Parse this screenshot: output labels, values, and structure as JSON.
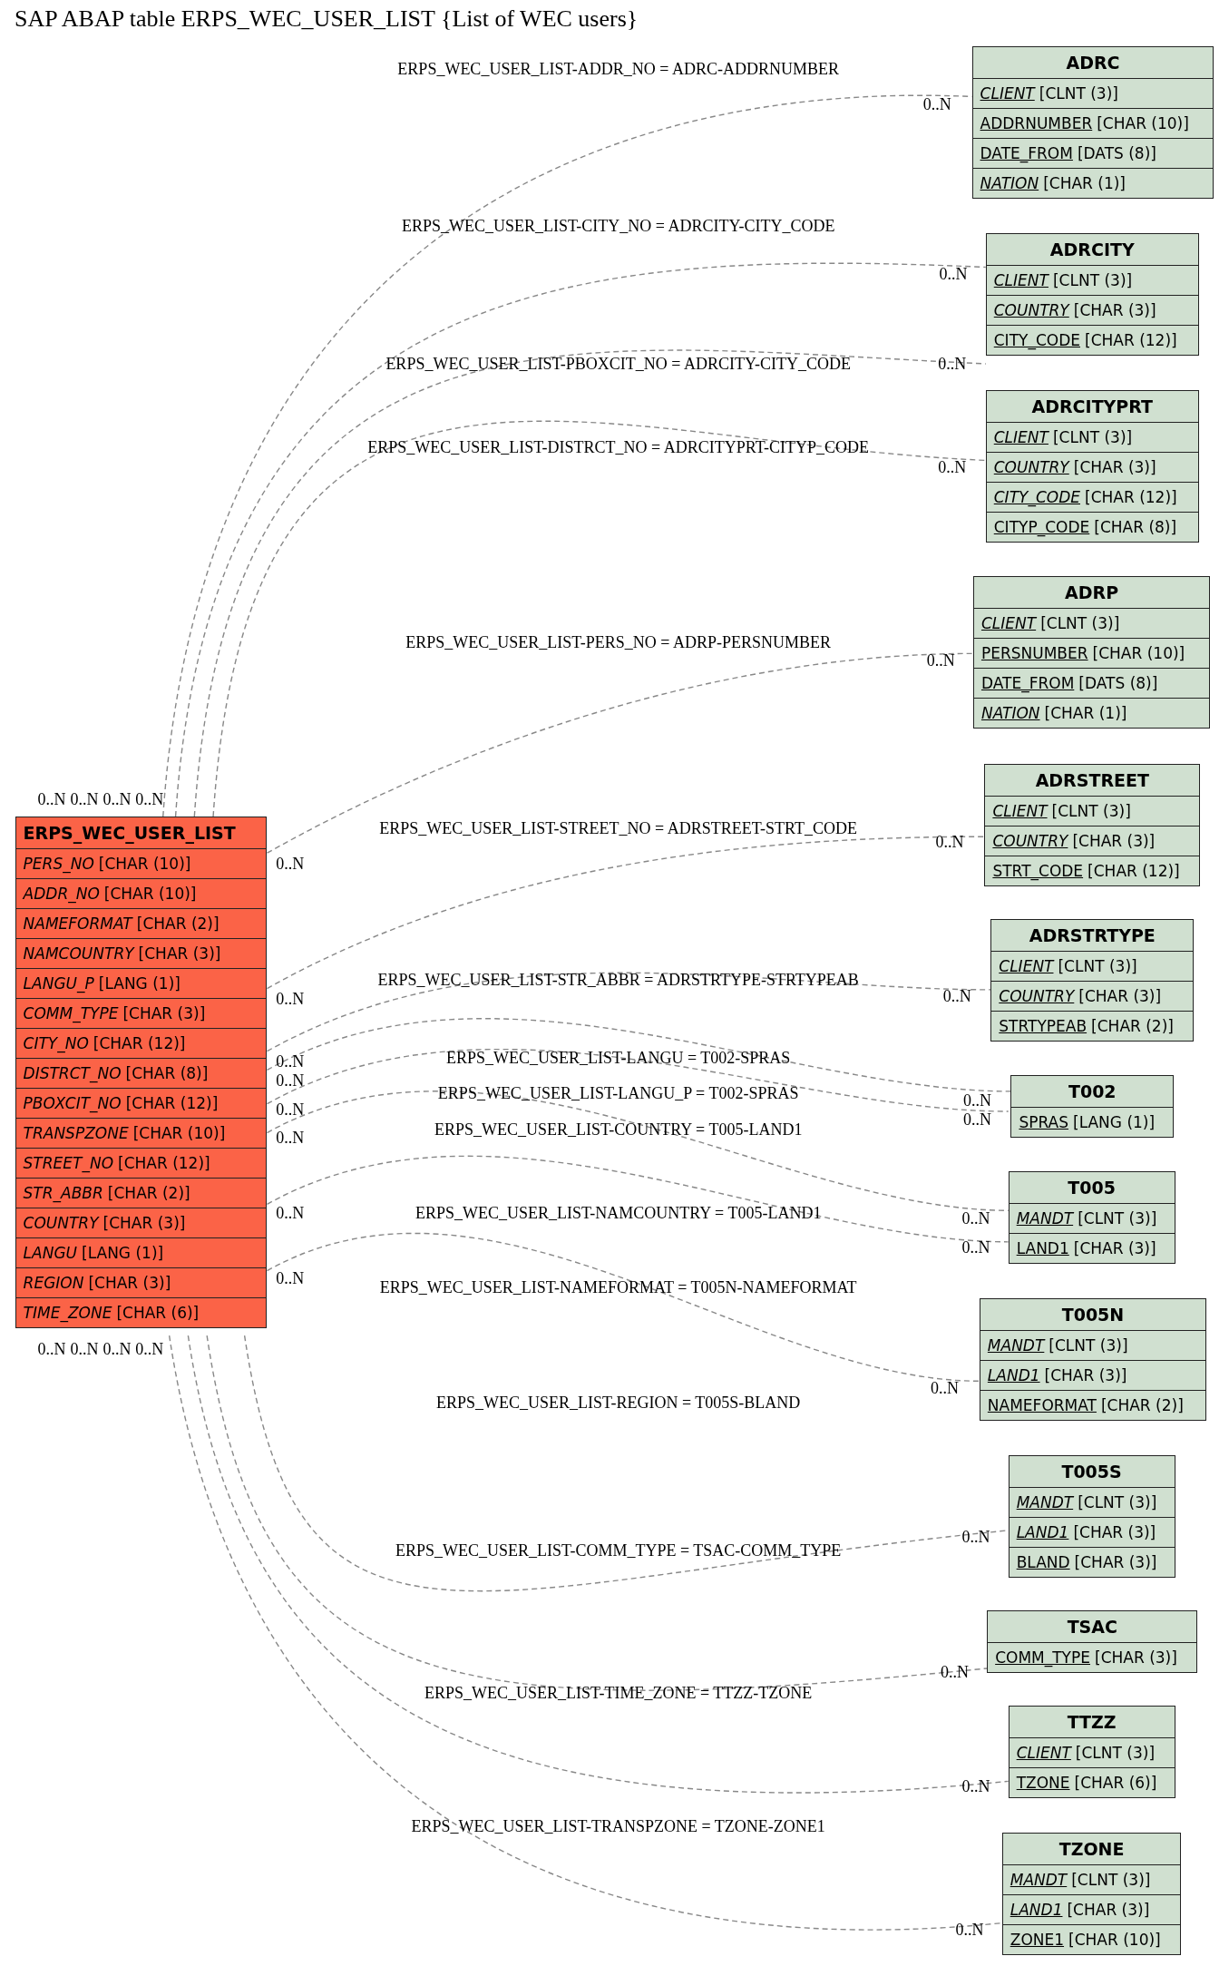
{
  "title": "SAP ABAP table ERPS_WEC_USER_LIST {List of WEC users}",
  "tables": [
    {
      "name": "ERPS_WEC_USER_LIST",
      "kind": "main",
      "fields": [
        {
          "name": "PERS_NO",
          "type": "[CHAR (10)]",
          "key": false,
          "italic": true
        },
        {
          "name": "ADDR_NO",
          "type": "[CHAR (10)]",
          "key": false,
          "italic": true
        },
        {
          "name": "NAMEFORMAT",
          "type": "[CHAR (2)]",
          "key": false,
          "italic": true
        },
        {
          "name": "NAMCOUNTRY",
          "type": "[CHAR (3)]",
          "key": false,
          "italic": true
        },
        {
          "name": "LANGU_P",
          "type": "[LANG (1)]",
          "key": false,
          "italic": true
        },
        {
          "name": "COMM_TYPE",
          "type": "[CHAR (3)]",
          "key": false,
          "italic": true
        },
        {
          "name": "CITY_NO",
          "type": "[CHAR (12)]",
          "key": false,
          "italic": true
        },
        {
          "name": "DISTRCT_NO",
          "type": "[CHAR (8)]",
          "key": false,
          "italic": true
        },
        {
          "name": "PBOXCIT_NO",
          "type": "[CHAR (12)]",
          "key": false,
          "italic": true
        },
        {
          "name": "TRANSPZONE",
          "type": "[CHAR (10)]",
          "key": false,
          "italic": true
        },
        {
          "name": "STREET_NO",
          "type": "[CHAR (12)]",
          "key": false,
          "italic": true
        },
        {
          "name": "STR_ABBR",
          "type": "[CHAR (2)]",
          "key": false,
          "italic": true
        },
        {
          "name": "COUNTRY",
          "type": "[CHAR (3)]",
          "key": false,
          "italic": true
        },
        {
          "name": "LANGU",
          "type": "[LANG (1)]",
          "key": false,
          "italic": true
        },
        {
          "name": "REGION",
          "type": "[CHAR (3)]",
          "key": false,
          "italic": true
        },
        {
          "name": "TIME_ZONE",
          "type": "[CHAR (6)]",
          "key": false,
          "italic": true
        }
      ]
    },
    {
      "name": "ADRC",
      "kind": "related",
      "fields": [
        {
          "name": "CLIENT",
          "type": "[CLNT (3)]",
          "key": true,
          "italic": true
        },
        {
          "name": "ADDRNUMBER",
          "type": "[CHAR (10)]",
          "key": true,
          "italic": false
        },
        {
          "name": "DATE_FROM",
          "type": "[DATS (8)]",
          "key": true,
          "italic": false
        },
        {
          "name": "NATION",
          "type": "[CHAR (1)]",
          "key": true,
          "italic": true
        }
      ]
    },
    {
      "name": "ADRCITY",
      "kind": "related",
      "fields": [
        {
          "name": "CLIENT",
          "type": "[CLNT (3)]",
          "key": true,
          "italic": true
        },
        {
          "name": "COUNTRY",
          "type": "[CHAR (3)]",
          "key": true,
          "italic": true
        },
        {
          "name": "CITY_CODE",
          "type": "[CHAR (12)]",
          "key": true,
          "italic": false
        }
      ]
    },
    {
      "name": "ADRCITYPRT",
      "kind": "related",
      "fields": [
        {
          "name": "CLIENT",
          "type": "[CLNT (3)]",
          "key": true,
          "italic": true
        },
        {
          "name": "COUNTRY",
          "type": "[CHAR (3)]",
          "key": true,
          "italic": true
        },
        {
          "name": "CITY_CODE",
          "type": "[CHAR (12)]",
          "key": true,
          "italic": true
        },
        {
          "name": "CITYP_CODE",
          "type": "[CHAR (8)]",
          "key": true,
          "italic": false
        }
      ]
    },
    {
      "name": "ADRP",
      "kind": "related",
      "fields": [
        {
          "name": "CLIENT",
          "type": "[CLNT (3)]",
          "key": true,
          "italic": true
        },
        {
          "name": "PERSNUMBER",
          "type": "[CHAR (10)]",
          "key": true,
          "italic": false
        },
        {
          "name": "DATE_FROM",
          "type": "[DATS (8)]",
          "key": true,
          "italic": false
        },
        {
          "name": "NATION",
          "type": "[CHAR (1)]",
          "key": true,
          "italic": true
        }
      ]
    },
    {
      "name": "ADRSTREET",
      "kind": "related",
      "fields": [
        {
          "name": "CLIENT",
          "type": "[CLNT (3)]",
          "key": true,
          "italic": true
        },
        {
          "name": "COUNTRY",
          "type": "[CHAR (3)]",
          "key": true,
          "italic": true
        },
        {
          "name": "STRT_CODE",
          "type": "[CHAR (12)]",
          "key": true,
          "italic": false
        }
      ]
    },
    {
      "name": "ADRSTRTYPE",
      "kind": "related",
      "fields": [
        {
          "name": "CLIENT",
          "type": "[CLNT (3)]",
          "key": true,
          "italic": true
        },
        {
          "name": "COUNTRY",
          "type": "[CHAR (3)]",
          "key": true,
          "italic": true
        },
        {
          "name": "STRTYPEAB",
          "type": "[CHAR (2)]",
          "key": true,
          "italic": false
        }
      ]
    },
    {
      "name": "T002",
      "kind": "related",
      "fields": [
        {
          "name": "SPRAS",
          "type": "[LANG (1)]",
          "key": true,
          "italic": false
        }
      ]
    },
    {
      "name": "T005",
      "kind": "related",
      "fields": [
        {
          "name": "MANDT",
          "type": "[CLNT (3)]",
          "key": true,
          "italic": true
        },
        {
          "name": "LAND1",
          "type": "[CHAR (3)]",
          "key": true,
          "italic": false
        }
      ]
    },
    {
      "name": "T005N",
      "kind": "related",
      "fields": [
        {
          "name": "MANDT",
          "type": "[CLNT (3)]",
          "key": true,
          "italic": true
        },
        {
          "name": "LAND1",
          "type": "[CHAR (3)]",
          "key": true,
          "italic": true
        },
        {
          "name": "NAMEFORMAT",
          "type": "[CHAR (2)]",
          "key": true,
          "italic": false
        }
      ]
    },
    {
      "name": "T005S",
      "kind": "related",
      "fields": [
        {
          "name": "MANDT",
          "type": "[CLNT (3)]",
          "key": true,
          "italic": true
        },
        {
          "name": "LAND1",
          "type": "[CHAR (3)]",
          "key": true,
          "italic": true
        },
        {
          "name": "BLAND",
          "type": "[CHAR (3)]",
          "key": true,
          "italic": false
        }
      ]
    },
    {
      "name": "TSAC",
      "kind": "related",
      "fields": [
        {
          "name": "COMM_TYPE",
          "type": "[CHAR (3)]",
          "key": true,
          "italic": false
        }
      ]
    },
    {
      "name": "TTZZ",
      "kind": "related",
      "fields": [
        {
          "name": "CLIENT",
          "type": "[CLNT (3)]",
          "key": true,
          "italic": true
        },
        {
          "name": "TZONE",
          "type": "[CHAR (6)]",
          "key": true,
          "italic": false
        }
      ]
    },
    {
      "name": "TZONE",
      "kind": "related",
      "fields": [
        {
          "name": "MANDT",
          "type": "[CLNT (3)]",
          "key": true,
          "italic": true
        },
        {
          "name": "LAND1",
          "type": "[CHAR (3)]",
          "key": true,
          "italic": true
        },
        {
          "name": "ZONE1",
          "type": "[CHAR (10)]",
          "key": true,
          "italic": false
        }
      ]
    }
  ],
  "relations": [
    {
      "label": "ERPS_WEC_USER_LIST-ADDR_NO = ADRC-ADDRNUMBER",
      "source_cardinality": "0..N",
      "target_cardinality": "0..N"
    },
    {
      "label": "ERPS_WEC_USER_LIST-CITY_NO = ADRCITY-CITY_CODE",
      "source_cardinality": "0..N",
      "target_cardinality": "0..N"
    },
    {
      "label": "ERPS_WEC_USER_LIST-PBOXCIT_NO = ADRCITY-CITY_CODE",
      "source_cardinality": "0..N",
      "target_cardinality": "0..N"
    },
    {
      "label": "ERPS_WEC_USER_LIST-DISTRCT_NO = ADRCITYPRT-CITYP_CODE",
      "source_cardinality": "0..N",
      "target_cardinality": "0..N"
    },
    {
      "label": "ERPS_WEC_USER_LIST-PERS_NO = ADRP-PERSNUMBER",
      "source_cardinality": "0..N",
      "target_cardinality": "0..N"
    },
    {
      "label": "ERPS_WEC_USER_LIST-STREET_NO = ADRSTREET-STRT_CODE",
      "source_cardinality": "0..N",
      "target_cardinality": "0..N"
    },
    {
      "label": "ERPS_WEC_USER_LIST-STR_ABBR = ADRSTRTYPE-STRTYPEAB",
      "source_cardinality": "0..N",
      "target_cardinality": "0..N"
    },
    {
      "label": "ERPS_WEC_USER_LIST-LANGU = T002-SPRAS",
      "source_cardinality": "0..N",
      "target_cardinality": "0..N"
    },
    {
      "label": "ERPS_WEC_USER_LIST-LANGU_P = T002-SPRAS",
      "source_cardinality": "0..N",
      "target_cardinality": "0..N"
    },
    {
      "label": "ERPS_WEC_USER_LIST-COUNTRY = T005-LAND1",
      "source_cardinality": "0..N",
      "target_cardinality": "0..N"
    },
    {
      "label": "ERPS_WEC_USER_LIST-NAMCOUNTRY = T005-LAND1",
      "source_cardinality": "0..N",
      "target_cardinality": "0..N"
    },
    {
      "label": "ERPS_WEC_USER_LIST-NAMEFORMAT = T005N-NAMEFORMAT",
      "source_cardinality": "0..N",
      "target_cardinality": "0..N"
    },
    {
      "label": "ERPS_WEC_USER_LIST-REGION = T005S-BLAND",
      "source_cardinality": "0..N",
      "target_cardinality": "0..N"
    },
    {
      "label": "ERPS_WEC_USER_LIST-COMM_TYPE = TSAC-COMM_TYPE",
      "source_cardinality": "0..N",
      "target_cardinality": "0..N"
    },
    {
      "label": "ERPS_WEC_USER_LIST-TIME_ZONE = TTZZ-TZONE",
      "source_cardinality": "0..N",
      "target_cardinality": "0..N"
    },
    {
      "label": "ERPS_WEC_USER_LIST-TRANSPZONE = TZONE-ZONE1",
      "source_cardinality": "0..N",
      "target_cardinality": "0..N"
    }
  ]
}
